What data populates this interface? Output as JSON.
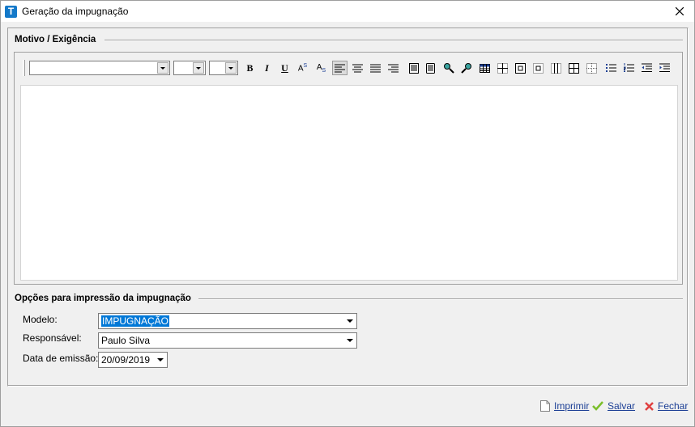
{
  "window": {
    "title": "Geração da impugnação",
    "icon_letter": "T"
  },
  "motivo": {
    "group_title": "Motivo / Exigência",
    "font_name": "",
    "font_size": "",
    "font_extra": ""
  },
  "toolbar": {
    "bold": "B",
    "italic": "I",
    "underline": "U",
    "superscript": "A",
    "superscript_mark": "S",
    "subscript": "A",
    "subscript_mark": "S"
  },
  "opcoes": {
    "group_title": "Opções para impressão da impugnação",
    "modelo_label": "Modelo:",
    "modelo_value": "IMPUGNAÇÃO",
    "responsavel_label": "Responsável:",
    "responsavel_value": "Paulo Silva",
    "data_label": "Data de emissão:",
    "data_value": "20/09/2019"
  },
  "footer": {
    "imprimir": "Imprimir",
    "salvar": "Salvar",
    "fechar": "Fechar"
  }
}
